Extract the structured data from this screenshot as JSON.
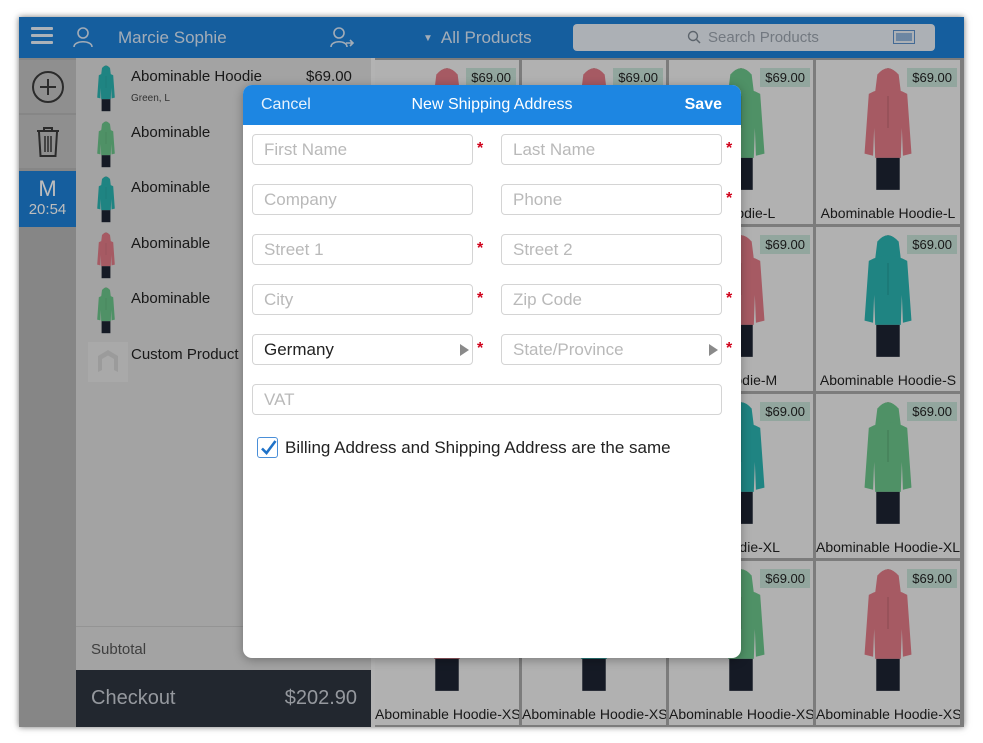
{
  "colors": {
    "accent": "#1d7fd6",
    "required": "#d0021b",
    "checkout_bg": "#2e3540",
    "price_tag": "#c5e0d6"
  },
  "topbar": {
    "customer_name": "Marcie Sophie",
    "category": "All Products",
    "search_placeholder": "Search Products"
  },
  "rail": {
    "user_initial": "M",
    "time": "20:54"
  },
  "cart": {
    "items": [
      {
        "name": "Abominable Hoodie",
        "options": "Green, L",
        "price": "$69.00",
        "color": "#2ab3b0"
      },
      {
        "name": "Abominable",
        "color": "#6bc48a"
      },
      {
        "name": "Abominable",
        "color": "#2ab3b0"
      },
      {
        "name": "Abominable",
        "color": "#e07a86"
      },
      {
        "name": "Abominable",
        "color": "#6bc48a"
      },
      {
        "name": "Custom Product",
        "color": "#cfcfcf"
      }
    ],
    "subtotal_label": "Subtotal",
    "checkout_label": "Checkout",
    "checkout_total": "$202.90"
  },
  "grid": {
    "tiles": [
      {
        "name": "",
        "price": "$69.00",
        "color": "#e07a86"
      },
      {
        "name": "",
        "price": "$69.00",
        "color": "#e07a86"
      },
      {
        "name": "e Hoodie-L",
        "price": "$69.00",
        "color": "#6bc48a"
      },
      {
        "name": "Abominable Hoodie-L",
        "price": "$69.00",
        "color": "#e07a86"
      },
      {
        "name": "",
        "price": "",
        "color": "#2ab3b0"
      },
      {
        "name": "",
        "price": "",
        "color": "#2ab3b0"
      },
      {
        "name": "e Hoodie-M",
        "price": "$69.00",
        "color": "#e07a86"
      },
      {
        "name": "Abominable Hoodie-S",
        "price": "$69.00",
        "color": "#2ab3b0"
      },
      {
        "name": "",
        "price": "",
        "color": "#6bc48a"
      },
      {
        "name": "",
        "price": "",
        "color": "#6bc48a"
      },
      {
        "name": "e Hoodie-XL",
        "price": "$69.00",
        "color": "#2ab3b0"
      },
      {
        "name": "Abominable Hoodie-XL",
        "price": "$69.00",
        "color": "#6bc48a"
      },
      {
        "name": "Abominable Hoodie-XS",
        "price": "",
        "color": "#e07a86"
      },
      {
        "name": "Abominable Hoodie-XS",
        "price": "",
        "color": "#2ab3b0"
      },
      {
        "name": "Abominable Hoodie-XS",
        "price": "$69.00",
        "color": "#6bc48a"
      },
      {
        "name": "Abominable Hoodie-XS",
        "price": "$69.00",
        "color": "#e07a86"
      }
    ]
  },
  "modal": {
    "title": "New Shipping Address",
    "cancel_label": "Cancel",
    "save_label": "Save",
    "placeholders": {
      "first_name": "First Name",
      "last_name": "Last Name",
      "company": "Company",
      "phone": "Phone",
      "street1": "Street 1",
      "street2": "Street 2",
      "city": "City",
      "zip": "Zip Code",
      "state": "State/Province",
      "vat": "VAT"
    },
    "country_value": "Germany",
    "required_mark": "*",
    "same_address_label": "Billing Address and Shipping Address are the same",
    "same_address_checked": true
  }
}
